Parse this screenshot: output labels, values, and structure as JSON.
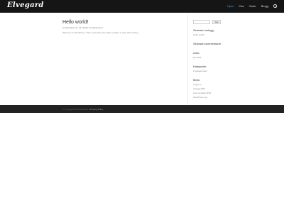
{
  "header": {
    "logo": "Elvegard",
    "nav": [
      "Hjem",
      "Oss",
      "Vister",
      "Blogg"
    ]
  },
  "post": {
    "title": "Hello world!",
    "meta_by": "av Elvegard",
    "meta_date": "jul. 12, 2019",
    "meta_category": "Uncategorized",
    "excerpt": "Welcome to WordPress. This is your first post. Edit or delete it, then start writing!"
  },
  "sidebar": {
    "search_placeholder": "",
    "search_button": "Søk",
    "widgets": [
      {
        "title": "Seneste innlegg",
        "items": [
          "Hello world!"
        ]
      },
      {
        "title": "Seneste kommentarer",
        "items": []
      },
      {
        "title": "Arkiv",
        "items": [
          "juli 2019"
        ]
      },
      {
        "title": "Kategorier",
        "items": [
          "Uncategorized"
        ]
      },
      {
        "title": "Meta",
        "items": [
          "Logg inn",
          "Innlegg RSS",
          "Kommentarer RSS",
          "WordPress.org"
        ]
      }
    ]
  },
  "footer": {
    "text": "© Copyright 2019 Elvegard  |",
    "link": "Privacy Policy"
  },
  "colors": {
    "accent": "#2ea3f2",
    "header_bg": "#151515",
    "footer_bg": "#222222"
  }
}
